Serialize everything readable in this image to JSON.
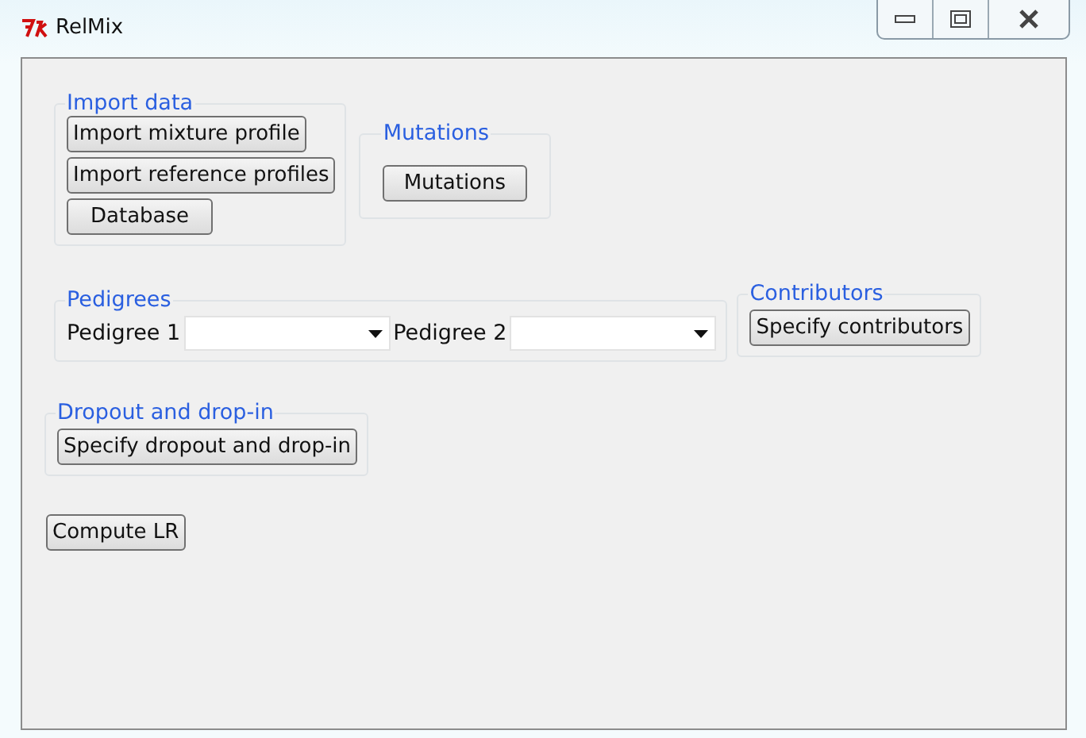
{
  "window": {
    "title": "RelMix"
  },
  "import_data": {
    "title": "Import data",
    "buttons": [
      "Import mixture profile",
      "Import reference profiles",
      "Database"
    ]
  },
  "mutations": {
    "title": "Mutations",
    "button": "Mutations"
  },
  "pedigrees": {
    "title": "Pedigrees",
    "fields": [
      {
        "label": "Pedigree 1"
      },
      {
        "label": "Pedigree 2"
      }
    ]
  },
  "contributors": {
    "title": "Contributors",
    "button": "Specify contributors"
  },
  "dropout": {
    "title": "Dropout and drop-in",
    "button": "Specify dropout and drop-in"
  },
  "compute_button": "Compute LR"
}
